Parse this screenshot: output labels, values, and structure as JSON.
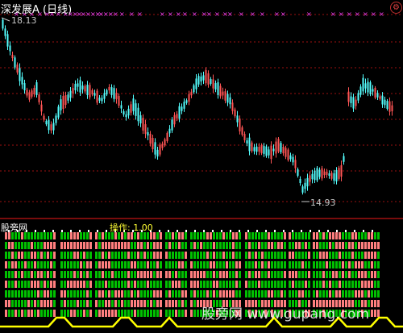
{
  "header": {
    "title": "深发展A (日线)",
    "gear_icon": "gear-icon"
  },
  "main_chart": {
    "high_label": "18.13",
    "low_label": "14.93",
    "candle_colors": {
      "up": "#ff5555",
      "down": "#54ffff"
    },
    "gridline_color": "#9b1010",
    "marker_color": "#ff44ff"
  },
  "sub_panel": {
    "title": "股旁网",
    "op_label": "操作: 1.00",
    "colors": {
      "green": "#00c000",
      "pink": "#ff7f7f",
      "yellow": "#ffff00"
    }
  },
  "watermark": {
    "text": "股旁网 www.gupang.com"
  },
  "chart_data": {
    "type": "candlestick",
    "title": "深发展A (日线)",
    "annotations": [
      {
        "text": "18.13",
        "series": "high"
      },
      {
        "text": "14.93",
        "series": "low"
      }
    ],
    "sub_panel_indicator": {
      "label": "操作",
      "value": 1.0
    }
  }
}
